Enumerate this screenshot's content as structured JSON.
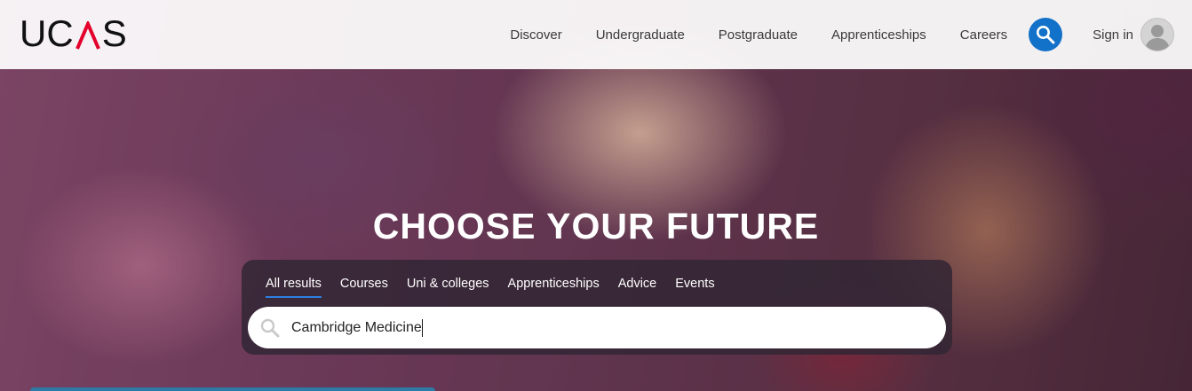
{
  "brand": {
    "logo_letters": [
      "U",
      "C",
      "S"
    ],
    "logo_accent_color": "#e4002b"
  },
  "nav": {
    "items": [
      {
        "label": "Discover"
      },
      {
        "label": "Undergraduate"
      },
      {
        "label": "Postgraduate"
      },
      {
        "label": "Apprenticeships"
      },
      {
        "label": "Careers"
      }
    ],
    "search_icon": "search-icon",
    "search_button_color": "#1271c8",
    "signin_label": "Sign in",
    "avatar_icon": "user-avatar-icon"
  },
  "hero": {
    "title": "CHOOSE YOUR FUTURE"
  },
  "search": {
    "tabs": [
      {
        "label": "All results",
        "active": true
      },
      {
        "label": "Courses",
        "active": false
      },
      {
        "label": "Uni & colleges",
        "active": false
      },
      {
        "label": "Apprenticeships",
        "active": false
      },
      {
        "label": "Advice",
        "active": false
      },
      {
        "label": "Events",
        "active": false
      }
    ],
    "active_tab_underline_color": "#2d7fe0",
    "input_value": "Cambridge Medicine",
    "input_icon": "search-icon"
  }
}
